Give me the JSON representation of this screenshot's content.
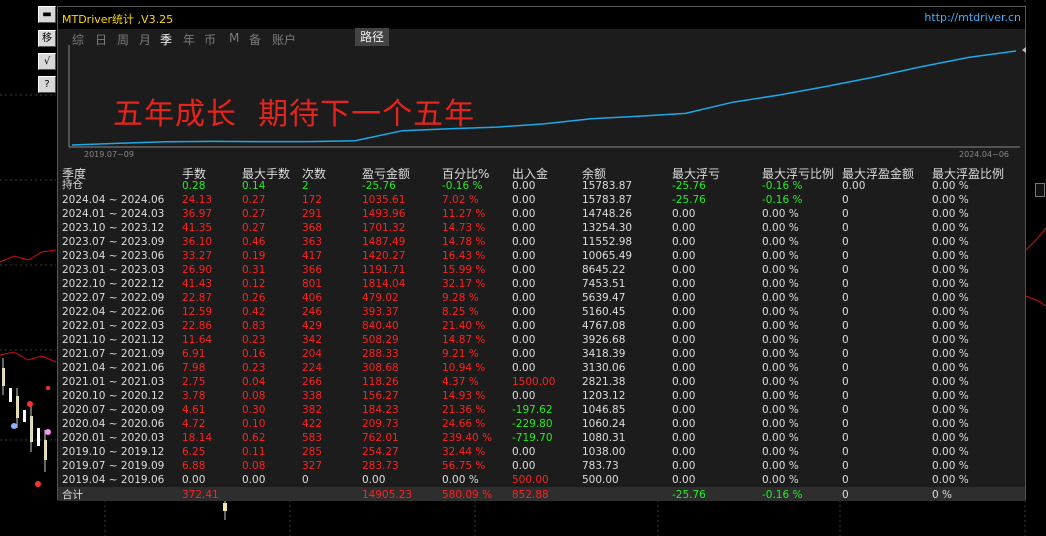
{
  "window": {
    "title": "MTDriver统计 ,V3.25",
    "url": "http://mtdriver.cn"
  },
  "sidebar_buttons": [
    "移",
    "√",
    "?"
  ],
  "tabs": [
    {
      "label": "综",
      "active": false
    },
    {
      "label": "日",
      "active": false
    },
    {
      "label": "周",
      "active": false
    },
    {
      "label": "月",
      "active": false
    },
    {
      "label": "季",
      "active": true
    },
    {
      "label": "年",
      "active": false
    },
    {
      "label": "币",
      "active": false
    },
    {
      "label": "M",
      "active": false
    },
    {
      "label": "备",
      "active": false
    },
    {
      "label": "账户",
      "active": false
    }
  ],
  "path_tab": "路径",
  "slogan": "五年成长  期待下一个五年",
  "equity_chart": {
    "start_date": "2019.07~09",
    "end_date": "2024.04~06",
    "line_color": "#1ea8e8",
    "balance": [
      500.0,
      783.73,
      1038.0,
      1080.31,
      1060.24,
      1046.85,
      1203.12,
      2821.38,
      3130.06,
      3418.39,
      3926.68,
      4767.08,
      5160.45,
      5639.47,
      7453.51,
      8645.22,
      10065.49,
      11552.98,
      13254.3,
      14748.26,
      15783.87
    ]
  },
  "table": {
    "headers": [
      "季度",
      "手数",
      "最大手数",
      "次数",
      "盈亏金额",
      "百分比%",
      "出入金",
      "余额",
      "最大浮亏",
      "最大浮亏比例",
      "最大浮盈金额",
      "最大浮盈比例"
    ],
    "holding": {
      "label": "持仓",
      "values": [
        "0.28",
        "0.14",
        "2",
        "-25.76",
        "-0.16 %",
        "0.00",
        "15783.87",
        "-25.76",
        "-0.16 %",
        "0.00",
        "0.00 %"
      ],
      "colors": [
        "green",
        "green",
        "green",
        "green",
        "green",
        "gray",
        "gray",
        "green",
        "green",
        "gray",
        "gray"
      ]
    },
    "rows": [
      {
        "period": "2024.04 ~ 2024.06",
        "lots": "24.13",
        "max_lots": "0.27",
        "count": "172",
        "pnl": "1035.61",
        "pct": "7.02 %",
        "flow": "0.00",
        "balance": "15783.87",
        "max_dd": "-25.76",
        "max_dd_pct": "-0.16 %",
        "max_fp": "0",
        "max_fp_pct": "0.00 %",
        "flow_color": "gray",
        "dd_color": "green"
      },
      {
        "period": "2024.01 ~ 2024.03",
        "lots": "36.97",
        "max_lots": "0.27",
        "count": "291",
        "pnl": "1493.96",
        "pct": "11.27 %",
        "flow": "0.00",
        "balance": "14748.26",
        "max_dd": "0.00",
        "max_dd_pct": "0.00 %",
        "max_fp": "0",
        "max_fp_pct": "0.00 %",
        "flow_color": "gray",
        "dd_color": "gray"
      },
      {
        "period": "2023.10 ~ 2023.12",
        "lots": "41.35",
        "max_lots": "0.27",
        "count": "368",
        "pnl": "1701.32",
        "pct": "14.73 %",
        "flow": "0.00",
        "balance": "13254.30",
        "max_dd": "0.00",
        "max_dd_pct": "0.00 %",
        "max_fp": "0",
        "max_fp_pct": "0.00 %",
        "flow_color": "gray",
        "dd_color": "gray"
      },
      {
        "period": "2023.07 ~ 2023.09",
        "lots": "36.10",
        "max_lots": "0.46",
        "count": "363",
        "pnl": "1487.49",
        "pct": "14.78 %",
        "flow": "0.00",
        "balance": "11552.98",
        "max_dd": "0.00",
        "max_dd_pct": "0.00 %",
        "max_fp": "0",
        "max_fp_pct": "0.00 %",
        "flow_color": "gray",
        "dd_color": "gray"
      },
      {
        "period": "2023.04 ~ 2023.06",
        "lots": "33.27",
        "max_lots": "0.19",
        "count": "417",
        "pnl": "1420.27",
        "pct": "16.43 %",
        "flow": "0.00",
        "balance": "10065.49",
        "max_dd": "0.00",
        "max_dd_pct": "0.00 %",
        "max_fp": "0",
        "max_fp_pct": "0.00 %",
        "flow_color": "gray",
        "dd_color": "gray"
      },
      {
        "period": "2023.01 ~ 2023.03",
        "lots": "26.90",
        "max_lots": "0.31",
        "count": "366",
        "pnl": "1191.71",
        "pct": "15.99 %",
        "flow": "0.00",
        "balance": "8645.22",
        "max_dd": "0.00",
        "max_dd_pct": "0.00 %",
        "max_fp": "0",
        "max_fp_pct": "0.00 %",
        "flow_color": "gray",
        "dd_color": "gray"
      },
      {
        "period": "2022.10 ~ 2022.12",
        "lots": "41.43",
        "max_lots": "0.12",
        "count": "801",
        "pnl": "1814.04",
        "pct": "32.17 %",
        "flow": "0.00",
        "balance": "7453.51",
        "max_dd": "0.00",
        "max_dd_pct": "0.00 %",
        "max_fp": "0",
        "max_fp_pct": "0.00 %",
        "flow_color": "gray",
        "dd_color": "gray"
      },
      {
        "period": "2022.07 ~ 2022.09",
        "lots": "22.87",
        "max_lots": "0.26",
        "count": "406",
        "pnl": "479.02",
        "pct": "9.28 %",
        "flow": "0.00",
        "balance": "5639.47",
        "max_dd": "0.00",
        "max_dd_pct": "0.00 %",
        "max_fp": "0",
        "max_fp_pct": "0.00 %",
        "flow_color": "gray",
        "dd_color": "gray"
      },
      {
        "period": "2022.04 ~ 2022.06",
        "lots": "12.59",
        "max_lots": "0.42",
        "count": "246",
        "pnl": "393.37",
        "pct": "8.25 %",
        "flow": "0.00",
        "balance": "5160.45",
        "max_dd": "0.00",
        "max_dd_pct": "0.00 %",
        "max_fp": "0",
        "max_fp_pct": "0.00 %",
        "flow_color": "gray",
        "dd_color": "gray"
      },
      {
        "period": "2022.01 ~ 2022.03",
        "lots": "22.86",
        "max_lots": "0.83",
        "count": "429",
        "pnl": "840.40",
        "pct": "21.40 %",
        "flow": "0.00",
        "balance": "4767.08",
        "max_dd": "0.00",
        "max_dd_pct": "0.00 %",
        "max_fp": "0",
        "max_fp_pct": "0.00 %",
        "flow_color": "gray",
        "dd_color": "gray"
      },
      {
        "period": "2021.10 ~ 2021.12",
        "lots": "11.64",
        "max_lots": "0.23",
        "count": "342",
        "pnl": "508.29",
        "pct": "14.87 %",
        "flow": "0.00",
        "balance": "3926.68",
        "max_dd": "0.00",
        "max_dd_pct": "0.00 %",
        "max_fp": "0",
        "max_fp_pct": "0.00 %",
        "flow_color": "gray",
        "dd_color": "gray"
      },
      {
        "period": "2021.07 ~ 2021.09",
        "lots": "6.91",
        "max_lots": "0.16",
        "count": "204",
        "pnl": "288.33",
        "pct": "9.21 %",
        "flow": "0.00",
        "balance": "3418.39",
        "max_dd": "0.00",
        "max_dd_pct": "0.00 %",
        "max_fp": "0",
        "max_fp_pct": "0.00 %",
        "flow_color": "gray",
        "dd_color": "gray"
      },
      {
        "period": "2021.04 ~ 2021.06",
        "lots": "7.98",
        "max_lots": "0.23",
        "count": "224",
        "pnl": "308.68",
        "pct": "10.94 %",
        "flow": "0.00",
        "balance": "3130.06",
        "max_dd": "0.00",
        "max_dd_pct": "0.00 %",
        "max_fp": "0",
        "max_fp_pct": "0.00 %",
        "flow_color": "gray",
        "dd_color": "gray"
      },
      {
        "period": "2021.01 ~ 2021.03",
        "lots": "2.75",
        "max_lots": "0.04",
        "count": "266",
        "pnl": "118.26",
        "pct": "4.37 %",
        "flow": "1500.00",
        "balance": "2821.38",
        "max_dd": "0.00",
        "max_dd_pct": "0.00 %",
        "max_fp": "0",
        "max_fp_pct": "0.00 %",
        "flow_color": "red",
        "dd_color": "gray"
      },
      {
        "period": "2020.10 ~ 2020.12",
        "lots": "3.78",
        "max_lots": "0.08",
        "count": "338",
        "pnl": "156.27",
        "pct": "14.93 %",
        "flow": "0.00",
        "balance": "1203.12",
        "max_dd": "0.00",
        "max_dd_pct": "0.00 %",
        "max_fp": "0",
        "max_fp_pct": "0.00 %",
        "flow_color": "gray",
        "dd_color": "gray"
      },
      {
        "period": "2020.07 ~ 2020.09",
        "lots": "4.61",
        "max_lots": "0.30",
        "count": "382",
        "pnl": "184.23",
        "pct": "21.36 %",
        "flow": "-197.62",
        "balance": "1046.85",
        "max_dd": "0.00",
        "max_dd_pct": "0.00 %",
        "max_fp": "0",
        "max_fp_pct": "0.00 %",
        "flow_color": "green",
        "dd_color": "gray"
      },
      {
        "period": "2020.04 ~ 2020.06",
        "lots": "4.72",
        "max_lots": "0.10",
        "count": "422",
        "pnl": "209.73",
        "pct": "24.66 %",
        "flow": "-229.80",
        "balance": "1060.24",
        "max_dd": "0.00",
        "max_dd_pct": "0.00 %",
        "max_fp": "0",
        "max_fp_pct": "0.00 %",
        "flow_color": "green",
        "dd_color": "gray"
      },
      {
        "period": "2020.01 ~ 2020.03",
        "lots": "18.14",
        "max_lots": "0.62",
        "count": "583",
        "pnl": "762.01",
        "pct": "239.40 %",
        "flow": "-719.70",
        "balance": "1080.31",
        "max_dd": "0.00",
        "max_dd_pct": "0.00 %",
        "max_fp": "0",
        "max_fp_pct": "0.00 %",
        "flow_color": "green",
        "dd_color": "gray"
      },
      {
        "period": "2019.10 ~ 2019.12",
        "lots": "6.25",
        "max_lots": "0.11",
        "count": "285",
        "pnl": "254.27",
        "pct": "32.44 %",
        "flow": "0.00",
        "balance": "1038.00",
        "max_dd": "0.00",
        "max_dd_pct": "0.00 %",
        "max_fp": "0",
        "max_fp_pct": "0.00 %",
        "flow_color": "gray",
        "dd_color": "gray"
      },
      {
        "period": "2019.07 ~ 2019.09",
        "lots": "6.88",
        "max_lots": "0.08",
        "count": "327",
        "pnl": "283.73",
        "pct": "56.75 %",
        "flow": "0.00",
        "balance": "783.73",
        "max_dd": "0.00",
        "max_dd_pct": "0.00 %",
        "max_fp": "0",
        "max_fp_pct": "0.00 %",
        "flow_color": "gray",
        "dd_color": "gray"
      },
      {
        "period": "2019.04 ~ 2019.06",
        "lots": "0.00",
        "max_lots": "0.00",
        "count": "0",
        "pnl": "0.00",
        "pct": "0.00 %",
        "flow": "500.00",
        "balance": "500.00",
        "max_dd": "0.00",
        "max_dd_pct": "0.00 %",
        "max_fp": "0",
        "max_fp_pct": "0.00 %",
        "flow_color": "red",
        "dd_color": "gray",
        "all_gray": true
      }
    ],
    "total": {
      "label": "合计",
      "lots": "372.41",
      "pnl": "14905.23",
      "pct": "580.09 %",
      "flow": "852.88",
      "max_dd": "-25.76",
      "max_dd_pct": "-0.16 %",
      "max_fp": "0",
      "max_fp_pct": "0 %"
    }
  },
  "colors": {
    "gain": "#ff2020",
    "loss": "#22ee22",
    "neutral": "#dcdcdc",
    "title": "#ffd700",
    "link": "#3ab4ff"
  }
}
